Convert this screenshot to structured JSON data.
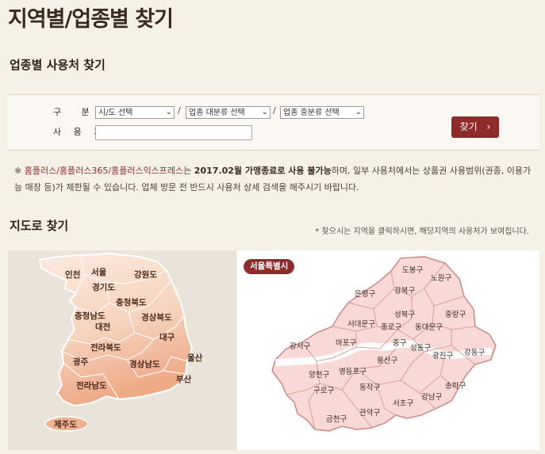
{
  "page": {
    "title": "지역별/업종별 찾기"
  },
  "search": {
    "section_title": "업종별 사용처 찾기",
    "category_label": "구 분",
    "place_label": "사 용 처",
    "region_select": "시/도 선택",
    "major_select": "업종 대분류 선택",
    "minor_select": "업종 중분류 선택",
    "slash": "/",
    "find_label": "찾기",
    "find_arrow": "›"
  },
  "notice": {
    "mark": "※ ",
    "brands": "홈플러스/홈플러스365/홈플러스익스프레스",
    "part1": "는 ",
    "bold": "2017.02월 가맹종료로 사용 불가능",
    "part2": "하며, 일부 사용처에서는 상품권 사용범위(권종, 이용가능 매장 등)가 제한될 수 있습니다. 업체 방문 전 반드시 사용처 상세 검색을 해주시기 바랍니다."
  },
  "map": {
    "section_title": "지도로 찾기",
    "hint": "* 찾으시는 지역을 클릭하시면, 해당지역의 사용처가 보여집니다.",
    "korea_regions": {
      "incheon": "인천",
      "seoul": "서울",
      "gangwon": "강원도",
      "gyeonggi": "경기도",
      "chungbuk": "충청북도",
      "chungnam": "충청남도",
      "daejeon": "대전",
      "gyeongbuk": "경상북도",
      "daegu": "대구",
      "jeonbuk": "전라북도",
      "ulsan": "울산",
      "gwangju": "광주",
      "gyeongnam": "경상남도",
      "busan": "부산",
      "jeonnam": "전라남도",
      "jeju": "제주도"
    },
    "seoul_badge": "서울특별시",
    "seoul_districts": {
      "dobong": "도봉구",
      "nowon": "노원구",
      "gangbuk": "강북구",
      "eunpyeong": "은평구",
      "seongbuk": "성북구",
      "jungnang": "중랑구",
      "seodaemun": "서대문구",
      "jongno": "종로구",
      "dongdaemun": "동대문구",
      "mapo": "마포구",
      "junggu": "중구",
      "gangseo": "강서구",
      "seongdong": "성동구",
      "gwangjin": "광진구",
      "gangdong": "강동구",
      "yongsan": "용산구",
      "yangcheon": "양천구",
      "yeongdeungpo": "영등포구",
      "guro": "구로구",
      "dongjak": "동작구",
      "songpa": "송파구",
      "seocho": "서초구",
      "gangnam": "강남구",
      "gwanak": "관악구",
      "geumcheon": "금천구"
    }
  },
  "colors": {
    "accent": "#8e2c2c",
    "background": "#f6f1e7",
    "map_land": "#f3cdb5",
    "seoul_fill": "#f9d9d6"
  }
}
